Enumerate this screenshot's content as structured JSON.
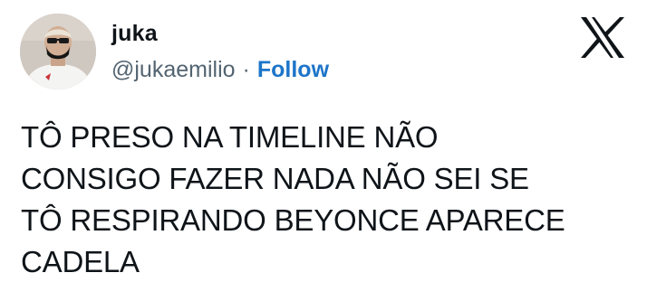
{
  "tweet": {
    "author": {
      "display_name": "juka",
      "handle": "@jukaemilio",
      "separator": "·",
      "follow_label": "Follow",
      "avatar_icon": "user-avatar-photo"
    },
    "platform_icon": "x-logo-icon",
    "text_lines": [
      "TÔ PRESO NA TIMELINE NÃO",
      "CONSIGO FAZER NADA NÃO SEI SE",
      "TÔ RESPIRANDO BEYONCE APARECE",
      "CADELA"
    ],
    "colors": {
      "text": "#0f1419",
      "secondary": "#536471",
      "follow": "#1d75c9"
    }
  }
}
